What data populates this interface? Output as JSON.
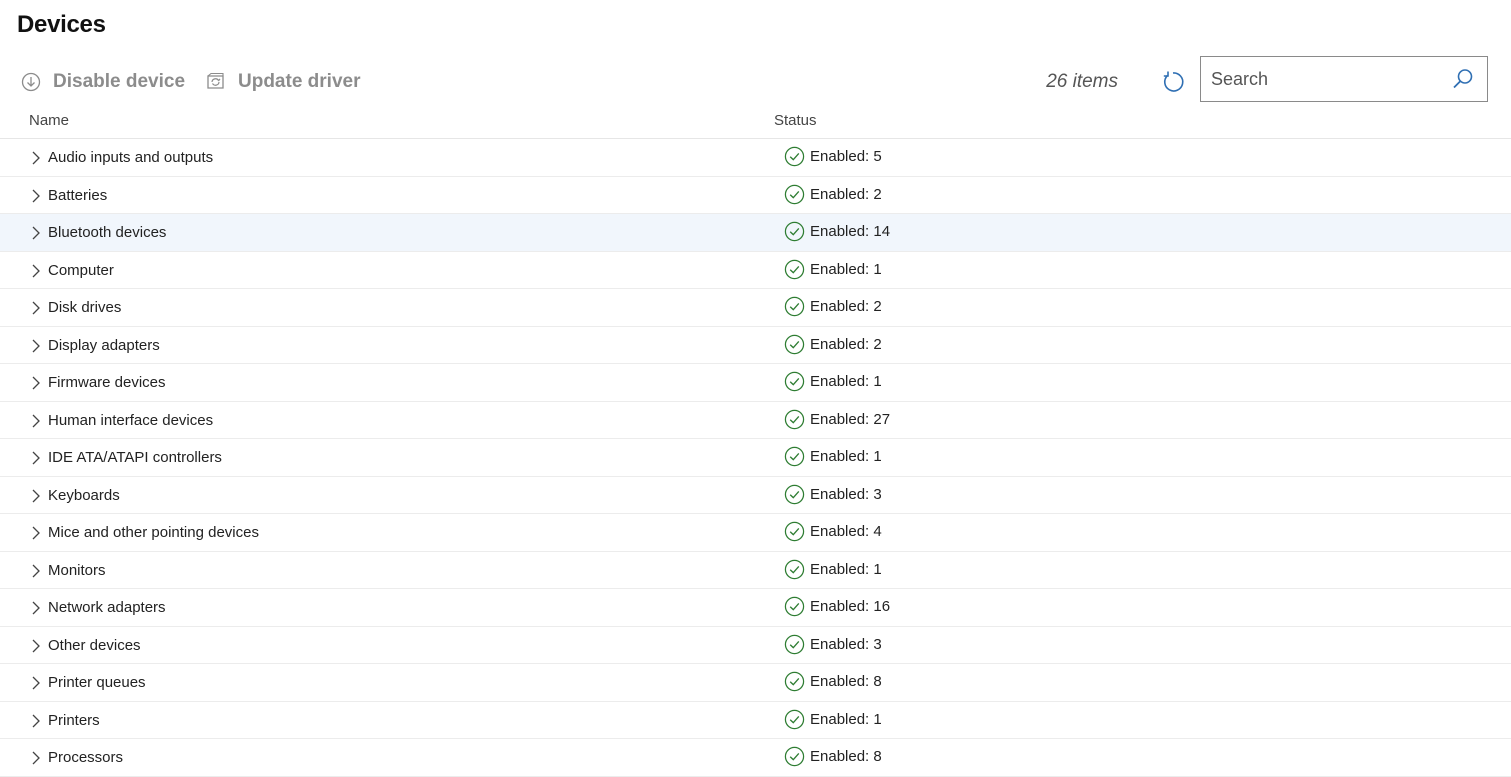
{
  "page": {
    "title": "Devices"
  },
  "toolbar": {
    "disable_label": "Disable device",
    "update_label": "Update driver",
    "item_count": "26 items",
    "search_placeholder": "Search"
  },
  "table": {
    "columns": {
      "name": "Name",
      "status": "Status"
    },
    "rows": [
      {
        "name": "Audio inputs and outputs",
        "status": "Enabled: 5"
      },
      {
        "name": "Batteries",
        "status": "Enabled: 2"
      },
      {
        "name": "Bluetooth devices",
        "status": "Enabled: 14"
      },
      {
        "name": "Computer",
        "status": "Enabled: 1"
      },
      {
        "name": "Disk drives",
        "status": "Enabled: 2"
      },
      {
        "name": "Display adapters",
        "status": "Enabled: 2"
      },
      {
        "name": "Firmware devices",
        "status": "Enabled: 1"
      },
      {
        "name": "Human interface devices",
        "status": "Enabled: 27"
      },
      {
        "name": "IDE ATA/ATAPI controllers",
        "status": "Enabled: 1"
      },
      {
        "name": "Keyboards",
        "status": "Enabled: 3"
      },
      {
        "name": "Mice and other pointing devices",
        "status": "Enabled: 4"
      },
      {
        "name": "Monitors",
        "status": "Enabled: 1"
      },
      {
        "name": "Network adapters",
        "status": "Enabled: 16"
      },
      {
        "name": "Other devices",
        "status": "Enabled: 3"
      },
      {
        "name": "Printer queues",
        "status": "Enabled: 8"
      },
      {
        "name": "Printers",
        "status": "Enabled: 1"
      },
      {
        "name": "Processors",
        "status": "Enabled: 8"
      }
    ]
  },
  "colors": {
    "accent": "#2f6fb3",
    "status_ok": "#2e7d32",
    "selected_row": "#f1f6fc",
    "disabled_text": "#8c8c8c"
  },
  "icons": {
    "disable": "arrow-down-circle-icon",
    "update": "update-driver-icon",
    "refresh": "refresh-icon",
    "search": "search-icon",
    "expand": "chevron-right-icon",
    "status": "check-circle-icon"
  }
}
